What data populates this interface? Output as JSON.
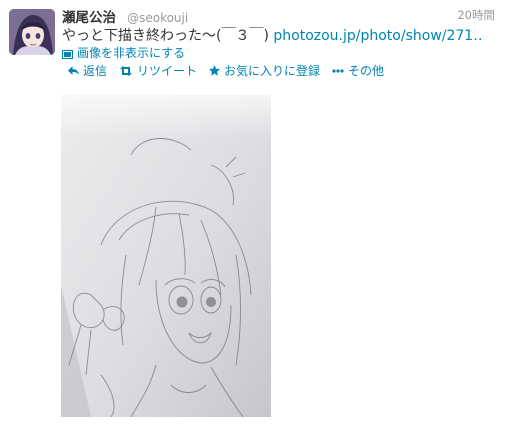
{
  "tweet": {
    "display_name": "瀬尾公治",
    "handle": "@seokouji",
    "timestamp": "20時間",
    "text": "やっと下描き終わった〜(￣３￣) ",
    "link": "photozou.jp/photo/show/271…",
    "media_toggle": "画像を非表示にする"
  },
  "actions": {
    "reply": "返信",
    "retweet": "リツイート",
    "favorite": "お気に入りに登録",
    "more": "その他"
  },
  "colors": {
    "link": "#0084b4",
    "muted": "#999999",
    "text": "#333333"
  },
  "icons": [
    "reply-icon",
    "retweet-icon",
    "star-icon",
    "dots-icon",
    "image-icon"
  ]
}
